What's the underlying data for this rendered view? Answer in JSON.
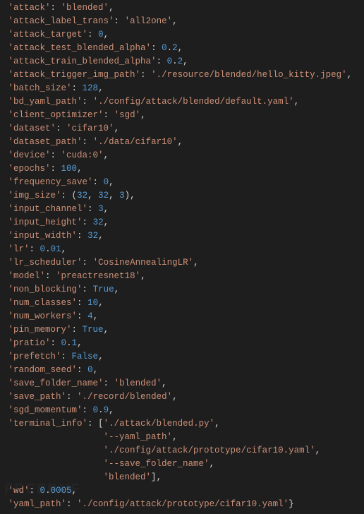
{
  "entries": [
    {
      "k": "attack",
      "type": "str",
      "v": "blended",
      "trail": ","
    },
    {
      "k": "attack_label_trans",
      "type": "str",
      "v": "all2one",
      "trail": ","
    },
    {
      "k": "attack_target",
      "type": "int",
      "v": "0",
      "trail": ","
    },
    {
      "k": "attack_test_blended_alpha",
      "type": "float",
      "whole": "0",
      "frac": "2",
      "trail": ","
    },
    {
      "k": "attack_train_blended_alpha",
      "type": "float",
      "whole": "0",
      "frac": "2",
      "trail": ","
    },
    {
      "k": "attack_trigger_img_path",
      "type": "str",
      "v": "./resource/blended/hello_kitty.jpeg",
      "trail": ","
    },
    {
      "k": "batch_size",
      "type": "int",
      "v": "128",
      "trail": ","
    },
    {
      "k": "bd_yaml_path",
      "type": "str",
      "v": "./config/attack/blended/default.yaml",
      "trail": ","
    },
    {
      "k": "client_optimizer",
      "type": "str",
      "v": "sgd",
      "trail": ","
    },
    {
      "k": "dataset",
      "type": "str",
      "v": "cifar10",
      "trail": ","
    },
    {
      "k": "dataset_path",
      "type": "str",
      "v": "./data/cifar10",
      "trail": ","
    },
    {
      "k": "device",
      "type": "str",
      "v": "cuda:0",
      "trail": ","
    },
    {
      "k": "epochs",
      "type": "int",
      "v": "100",
      "trail": ","
    },
    {
      "k": "frequency_save",
      "type": "int",
      "v": "0",
      "trail": ","
    },
    {
      "k": "img_size",
      "type": "tuple",
      "vals": [
        "32",
        "32",
        "3"
      ],
      "trail": ","
    },
    {
      "k": "input_channel",
      "type": "int",
      "v": "3",
      "trail": ","
    },
    {
      "k": "input_height",
      "type": "int",
      "v": "32",
      "trail": ","
    },
    {
      "k": "input_width",
      "type": "int",
      "v": "32",
      "trail": ","
    },
    {
      "k": "lr",
      "type": "float",
      "whole": "0",
      "frac": "01",
      "trail": ","
    },
    {
      "k": "lr_scheduler",
      "type": "str",
      "v": "CosineAnnealingLR",
      "trail": ","
    },
    {
      "k": "model",
      "type": "str",
      "v": "preactresnet18",
      "trail": ","
    },
    {
      "k": "non_blocking",
      "type": "bool",
      "v": "True",
      "trail": ","
    },
    {
      "k": "num_classes",
      "type": "int",
      "v": "10",
      "trail": ","
    },
    {
      "k": "num_workers",
      "type": "int",
      "v": "4",
      "trail": ","
    },
    {
      "k": "pin_memory",
      "type": "bool",
      "v": "True",
      "trail": ","
    },
    {
      "k": "pratio",
      "type": "float",
      "whole": "0",
      "frac": "1",
      "trail": ","
    },
    {
      "k": "prefetch",
      "type": "bool",
      "v": "False",
      "trail": ","
    },
    {
      "k": "random_seed",
      "type": "int",
      "v": "0",
      "trail": ","
    },
    {
      "k": "save_folder_name",
      "type": "str",
      "v": "blended",
      "trail": ","
    },
    {
      "k": "save_path",
      "type": "str",
      "v": "./record/blended",
      "trail": ","
    },
    {
      "k": "sgd_momentum",
      "type": "float",
      "whole": "0",
      "frac": "9",
      "trail": ","
    },
    {
      "k": "terminal_info",
      "type": "list",
      "items": [
        "./attack/blended.py",
        "--yaml_path",
        "./config/attack/prototype/cifar10.yaml",
        "--save_folder_name",
        "blended"
      ],
      "trail": ","
    },
    {
      "k": "wd",
      "type": "float",
      "whole": "0",
      "frac": "0005",
      "trail": ","
    },
    {
      "k": "yaml_path",
      "type": "str",
      "v": "./config/attack/prototype/cifar10.yaml",
      "trail": "}"
    }
  ],
  "watermark": "FREEBUF"
}
